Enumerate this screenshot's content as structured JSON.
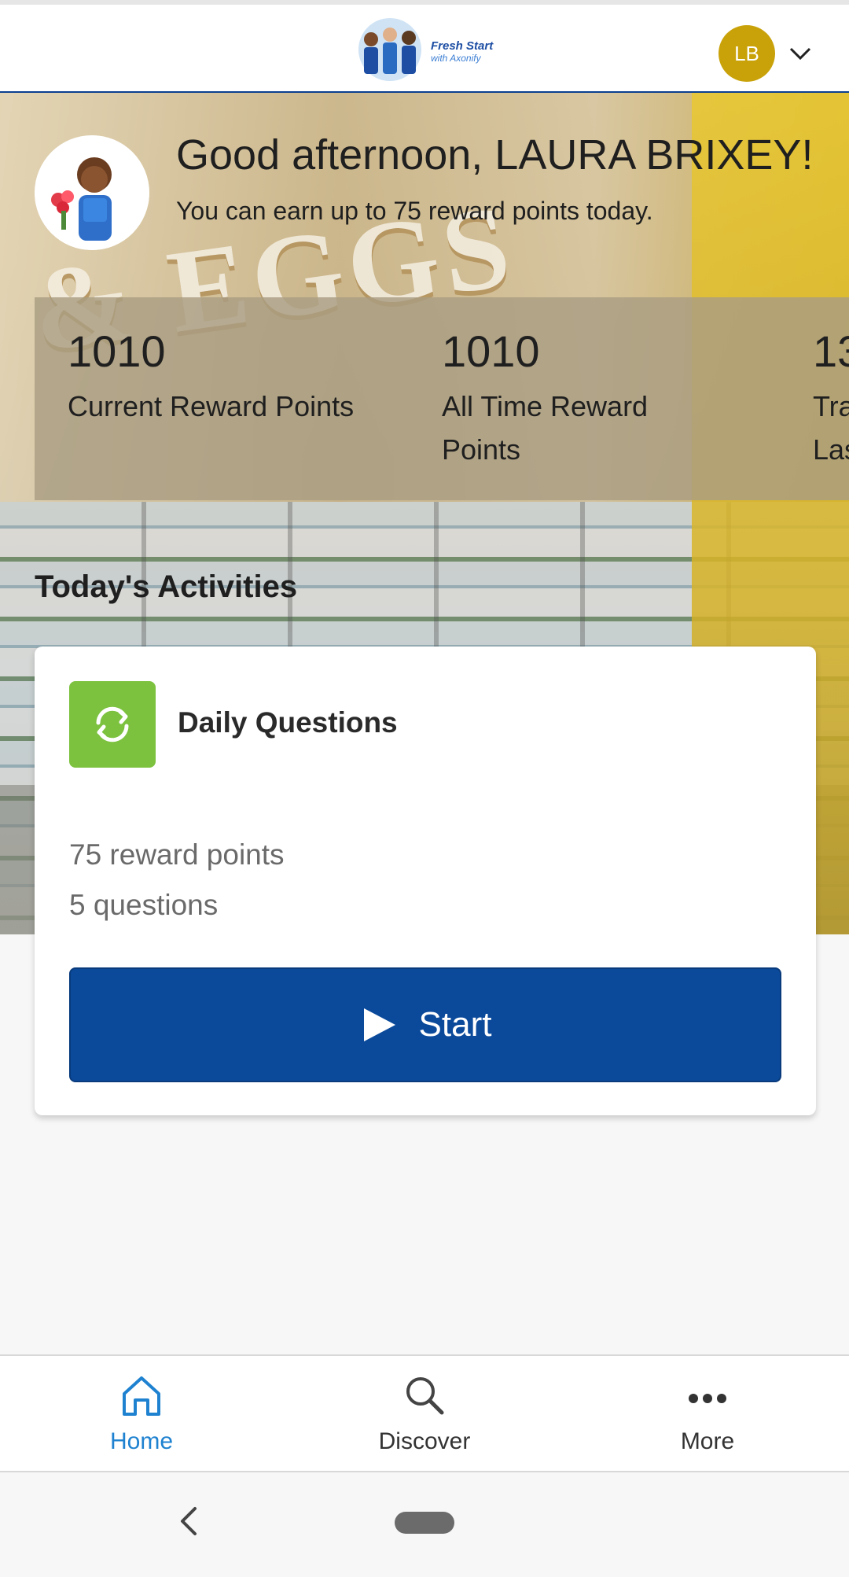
{
  "header": {
    "logo_line1": "Fresh Start",
    "logo_line2": "with Axonify",
    "avatar_initials": "LB"
  },
  "hero": {
    "greeting": "Good afternoon, LAURA BRIXEY!",
    "subtitle": "You can earn up to 75 reward points today.",
    "stats": [
      {
        "value": "1010",
        "label_line1": "Current Reward Points",
        "label_line2": ""
      },
      {
        "value": "1010",
        "label_line1": "All Time Reward",
        "label_line2": "Points"
      },
      {
        "value": "13",
        "label_line1": "Tra",
        "label_line2": "Las"
      }
    ]
  },
  "activities": {
    "section_title": "Today's Activities",
    "card": {
      "title": "Daily Questions",
      "reward": "75 reward points",
      "questions": "5 questions",
      "button_label": "Start"
    }
  },
  "bottom_nav": {
    "items": [
      {
        "label": "Home",
        "icon": "home-icon",
        "active": true
      },
      {
        "label": "Discover",
        "icon": "search-icon",
        "active": false
      },
      {
        "label": "More",
        "icon": "more-icon",
        "active": false
      }
    ]
  },
  "colors": {
    "brand_blue": "#0b4a9b",
    "accent_active": "#1f82d0",
    "activity_green": "#7cc23e",
    "avatar_gold": "#c9a20a"
  }
}
